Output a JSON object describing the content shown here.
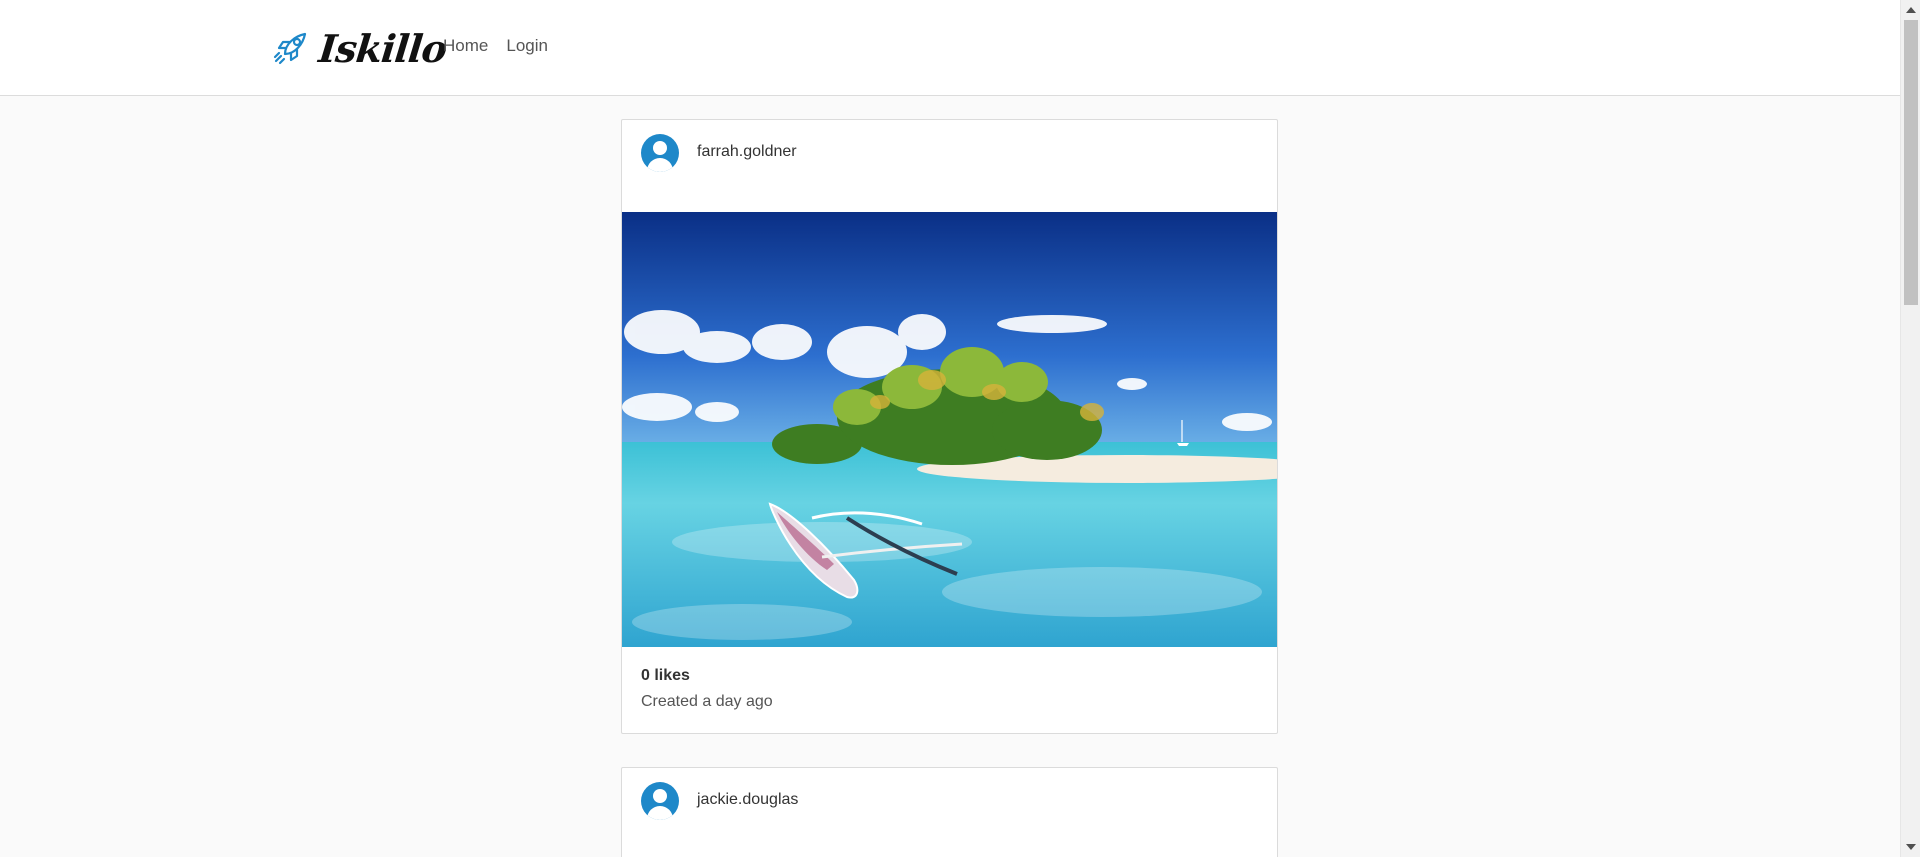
{
  "nav": {
    "brand": "Iskillo",
    "links": [
      "Home",
      "Login"
    ]
  },
  "posts": [
    {
      "username": "farrah.goldner",
      "likes": "0 likes",
      "created": "Created a day ago"
    },
    {
      "username": "jackie.douglas"
    }
  ],
  "icons": {
    "brand": "rocket-icon",
    "avatar": "user-avatar-icon"
  },
  "colors": {
    "accent": "#1e88c9",
    "background": "#fafafa"
  }
}
